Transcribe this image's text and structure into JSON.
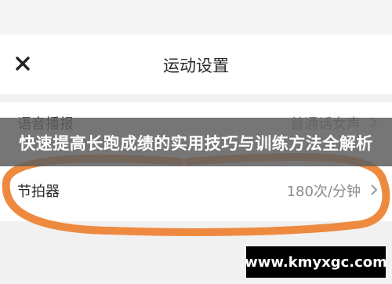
{
  "nav": {
    "title": "运动设置",
    "close_icon": "close-icon"
  },
  "settings": {
    "voice": {
      "label": "语音播报",
      "value": "普通话女声"
    },
    "metronome": {
      "label": "节拍器",
      "value": "180次/分钟"
    }
  },
  "banner": {
    "text": "快速提高长跑成绩的实用技巧与训练方法全解析"
  },
  "watermark": {
    "text": "www.kmyxgc.com"
  },
  "colors": {
    "highlight_stroke": "#ee8a3f",
    "banner_bg": "#606060",
    "watermark_bg": "#000000"
  }
}
